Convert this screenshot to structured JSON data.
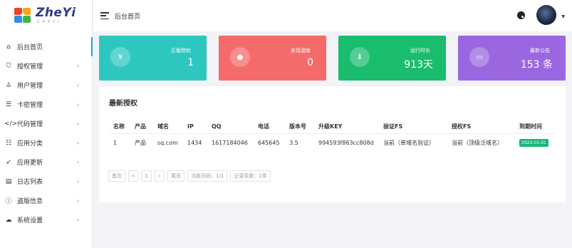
{
  "app": {
    "logo_title": "ZheYi",
    "logo_sub": "ZHEYI"
  },
  "sidebar": {
    "items": [
      {
        "label": "后台首页",
        "icon": "home-icon"
      },
      {
        "label": "授权管理",
        "icon": "shield-icon"
      },
      {
        "label": "用户管理",
        "icon": "user-icon"
      },
      {
        "label": "卡密管理",
        "icon": "list-icon"
      },
      {
        "label": "代码管理",
        "icon": "code-icon"
      },
      {
        "label": "应用分类",
        "icon": "category-icon"
      },
      {
        "label": "应用更新",
        "icon": "rocket-icon"
      },
      {
        "label": "日志列表",
        "icon": "log-icon"
      },
      {
        "label": "盗版信息",
        "icon": "info-icon"
      },
      {
        "label": "系统设置",
        "icon": "cloud-icon"
      }
    ]
  },
  "header": {
    "title": "后台首页"
  },
  "cards": [
    {
      "label": "正版授权",
      "value": "1",
      "icon": "yen-icon",
      "color": "#2ec7c0"
    },
    {
      "label": "发现盗版",
      "value": "0",
      "icon": "user-icon",
      "color": "#f56a6a"
    },
    {
      "label": "运行时长",
      "value": "913天",
      "icon": "download-icon",
      "color": "#1abc6e"
    },
    {
      "label": "最新公告",
      "value": "153 条",
      "icon": "message-icon",
      "color": "#9a67e0"
    }
  ],
  "panel": {
    "title": "最新授权",
    "columns": [
      "名称",
      "产品",
      "域名",
      "IP",
      "QQ",
      "电话",
      "版本号",
      "升级KEY",
      "验证FS",
      "授权FS",
      "到期时间"
    ],
    "rows": [
      [
        "1",
        "产品",
        "sq.com",
        "1434",
        "1617184046",
        "645645",
        "3.5",
        "994593f863cc808d",
        "当前（单域名验证）",
        "当前（顶级泛域名）",
        "2022-01-01"
      ]
    ]
  },
  "pager": {
    "first": "首页",
    "prev": "«",
    "page": "1",
    "next": "»",
    "last": "尾页",
    "current": "当前页码：1/1",
    "count": "记录条数：1条"
  }
}
